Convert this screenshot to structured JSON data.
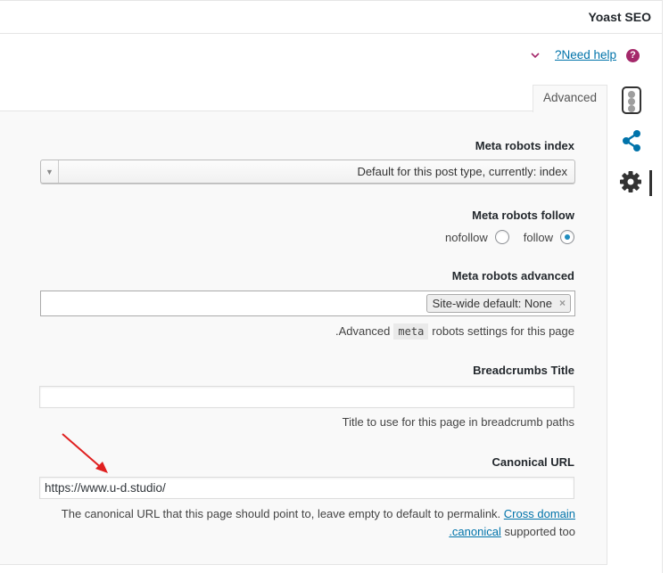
{
  "header": {
    "title": "Yoast SEO"
  },
  "help": {
    "link_label": "?Need help",
    "icon": "question-mark-icon",
    "qmark": "?"
  },
  "tabs": [
    {
      "label": "Advanced"
    }
  ],
  "sidebar": {
    "icons": [
      "traffic-light-icon",
      "share-icon",
      "gear-icon"
    ]
  },
  "meta_robots_index": {
    "label": "Meta robots index",
    "selected": "Default for this post type, currently: index"
  },
  "meta_robots_follow": {
    "label": "Meta robots follow",
    "options": [
      {
        "label": "nofollow",
        "checked": false
      },
      {
        "label": "follow",
        "checked": true
      }
    ]
  },
  "meta_robots_advanced": {
    "label": "Meta robots advanced",
    "chip": "Site-wide default: None",
    "chip_remove": "×",
    "help_prefix": ".Advanced",
    "help_code": "meta",
    "help_suffix": "robots settings for this page"
  },
  "breadcrumbs_title": {
    "label": "Breadcrumbs Title",
    "value": "",
    "help": "Title to use for this page in breadcrumb paths"
  },
  "canonical_url": {
    "label": "Canonical URL",
    "value": "https://www.u-d.studio/",
    "help_text": "The canonical URL that this page should point to, leave empty to default to permalink.",
    "link1": "Cross domain",
    "link2": ".canonical",
    "help_tail": "supported too"
  },
  "colors": {
    "link": "#0073aa",
    "brand": "#a4286a",
    "radio_checked": "#1e8cbe",
    "annotation_arrow": "#e02020"
  }
}
